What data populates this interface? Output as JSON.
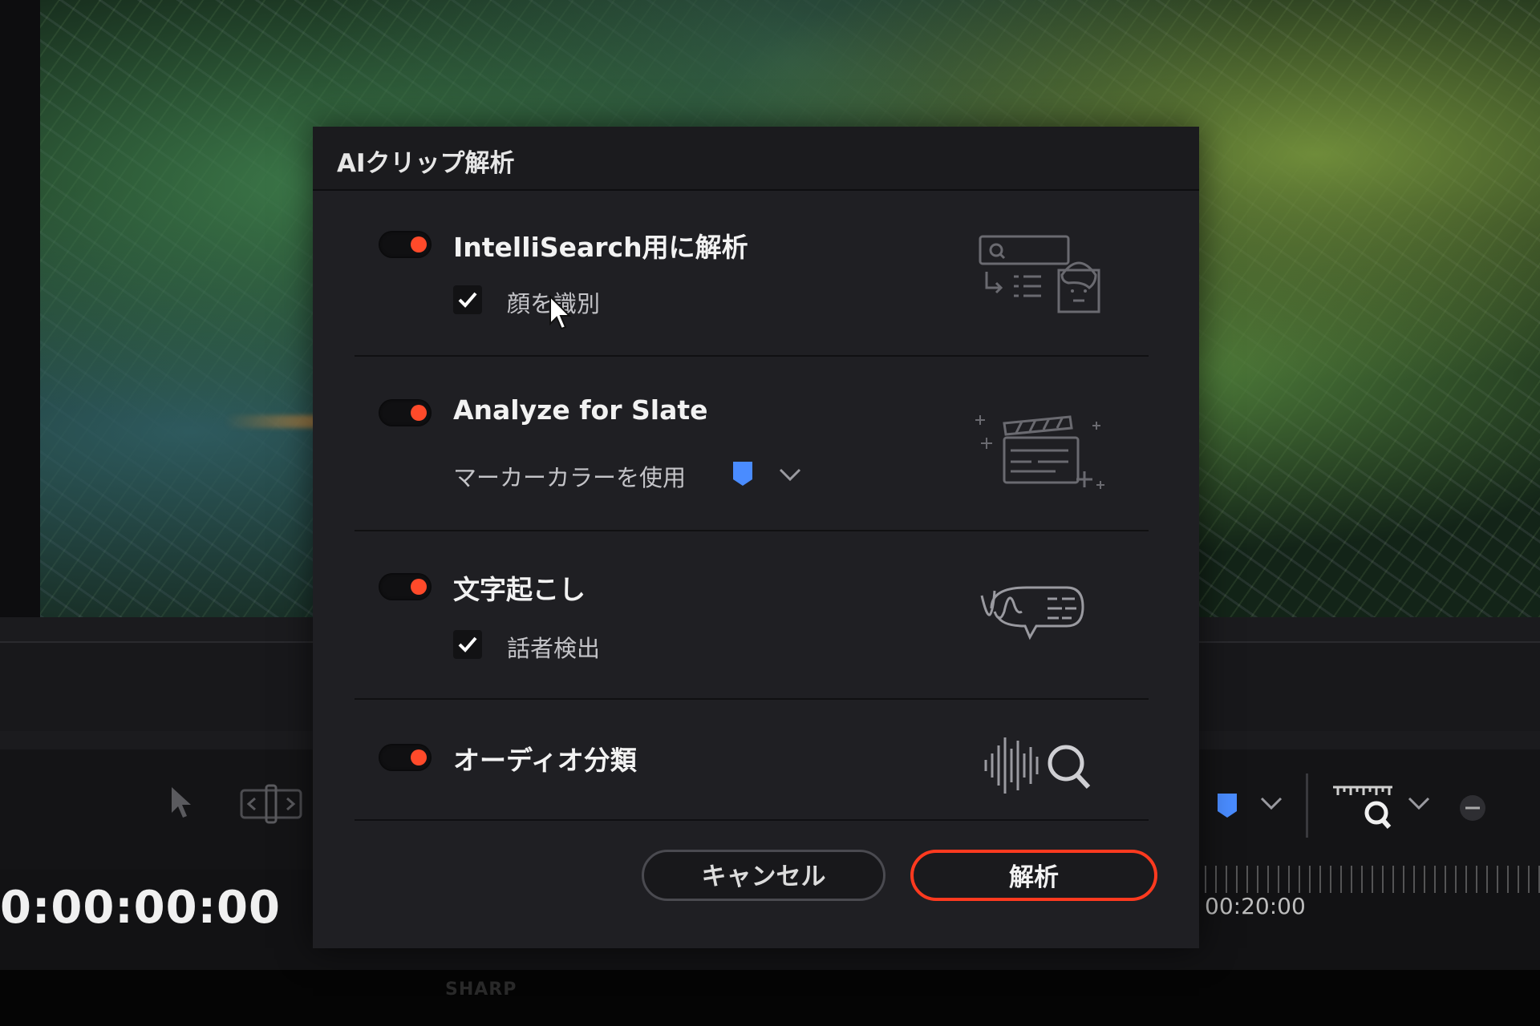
{
  "dialog": {
    "title": "AIクリップ解析",
    "sections": [
      {
        "title": "IntelliSearch用に解析",
        "enabled": true,
        "option_label": "顔を識別",
        "option_checked": true,
        "illustration": "intellisearch-illustration-icon"
      },
      {
        "title": "Analyze for Slate",
        "enabled": true,
        "option_label": "マーカーカラーを使用",
        "marker_color": "#4a8cff",
        "illustration": "clapperboard-icon"
      },
      {
        "title": "文字起こし",
        "enabled": true,
        "option_label": "話者検出",
        "option_checked": true,
        "illustration": "speech-transcription-icon"
      },
      {
        "title": "オーディオ分類",
        "enabled": true,
        "illustration": "audio-search-icon"
      }
    ],
    "buttons": {
      "cancel": "キャンセル",
      "analyze": "解析"
    }
  },
  "timeline": {
    "timecode": "0:00:00:00",
    "ruler_timecode": "00:20:00"
  },
  "monitor": {
    "brand": "SHARP"
  },
  "colors": {
    "toggle_on": "#ff4a2a",
    "accent_button_border": "#ff3a1f",
    "dialog_bg": "#1f1f23",
    "marker_blue": "#4a8cff"
  }
}
